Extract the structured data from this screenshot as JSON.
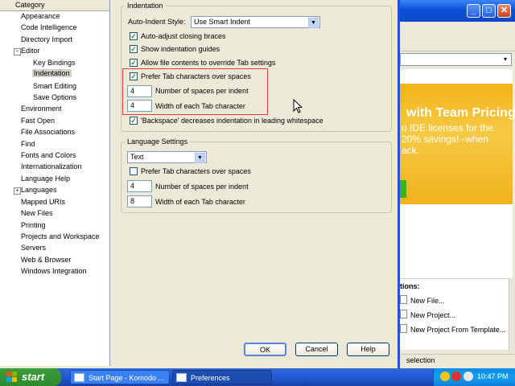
{
  "bg_window": {
    "banner_title": "with Team Pricing",
    "banner_text": "o IDE licenses for the\n20% savings!--when\nack.",
    "tasks_title": "tions:",
    "tasks": [
      "New File...",
      "New Project...",
      "New Project From Template..."
    ],
    "status": "selection"
  },
  "tree": {
    "header": "Category",
    "items": [
      {
        "label": "Appearance"
      },
      {
        "label": "Code Intelligence"
      },
      {
        "label": "Directory Import"
      },
      {
        "label": "Editor"
      },
      {
        "label": "Key Bindings"
      },
      {
        "label": "Indentation"
      },
      {
        "label": "Smart Editing"
      },
      {
        "label": "Save Options"
      },
      {
        "label": "Environment"
      },
      {
        "label": "Fast Open"
      },
      {
        "label": "File Associations"
      },
      {
        "label": "Find"
      },
      {
        "label": "Fonts and Colors"
      },
      {
        "label": "Internationalization"
      },
      {
        "label": "Language Help"
      },
      {
        "label": "Languages"
      },
      {
        "label": "Mapped URIs"
      },
      {
        "label": "New Files"
      },
      {
        "label": "Printing"
      },
      {
        "label": "Projects and Workspace"
      },
      {
        "label": "Servers"
      },
      {
        "label": "Web & Browser"
      },
      {
        "label": "Windows Integration"
      }
    ],
    "selected": "Indentation"
  },
  "indentation": {
    "legend": "Indentation",
    "auto_indent_label": "Auto-Indent Style:",
    "auto_indent_value": "Use Smart Indent",
    "auto_adjust_label": "Auto-adjust closing braces",
    "auto_adjust_checked": true,
    "show_guides_label": "Show indentation guides",
    "show_guides_checked": true,
    "allow_override_label": "Allow file contents to override Tab settings",
    "allow_override_checked": true,
    "prefer_tabs_label": "Prefer Tab characters over spaces",
    "prefer_tabs_checked": true,
    "spaces_value": "4",
    "spaces_label": "Number of spaces per indent",
    "tab_width_value": "4",
    "tab_width_label": "Width of each Tab character",
    "backspace_label": "'Backspace' decreases indentation in leading whitespace",
    "backspace_checked": true
  },
  "language_settings": {
    "legend": "Language Settings",
    "language_value": "Text",
    "prefer_tabs_label": "Prefer Tab characters over spaces",
    "prefer_tabs_checked": false,
    "spaces_value": "4",
    "spaces_label": "Number of spaces per indent",
    "tab_width_value": "8",
    "tab_width_label": "Width of each Tab character"
  },
  "buttons": {
    "ok": "OK",
    "cancel": "Cancel",
    "help": "Help"
  },
  "taskbar": {
    "start": "start",
    "tasks": [
      "Start Page - Komodo ...",
      "Preferences"
    ],
    "clock": "10:47 PM"
  },
  "colors": {
    "highlight": "#e33b3b",
    "taskbar": "#245edb",
    "start": "#3c9c3c",
    "check": "#21a121"
  }
}
